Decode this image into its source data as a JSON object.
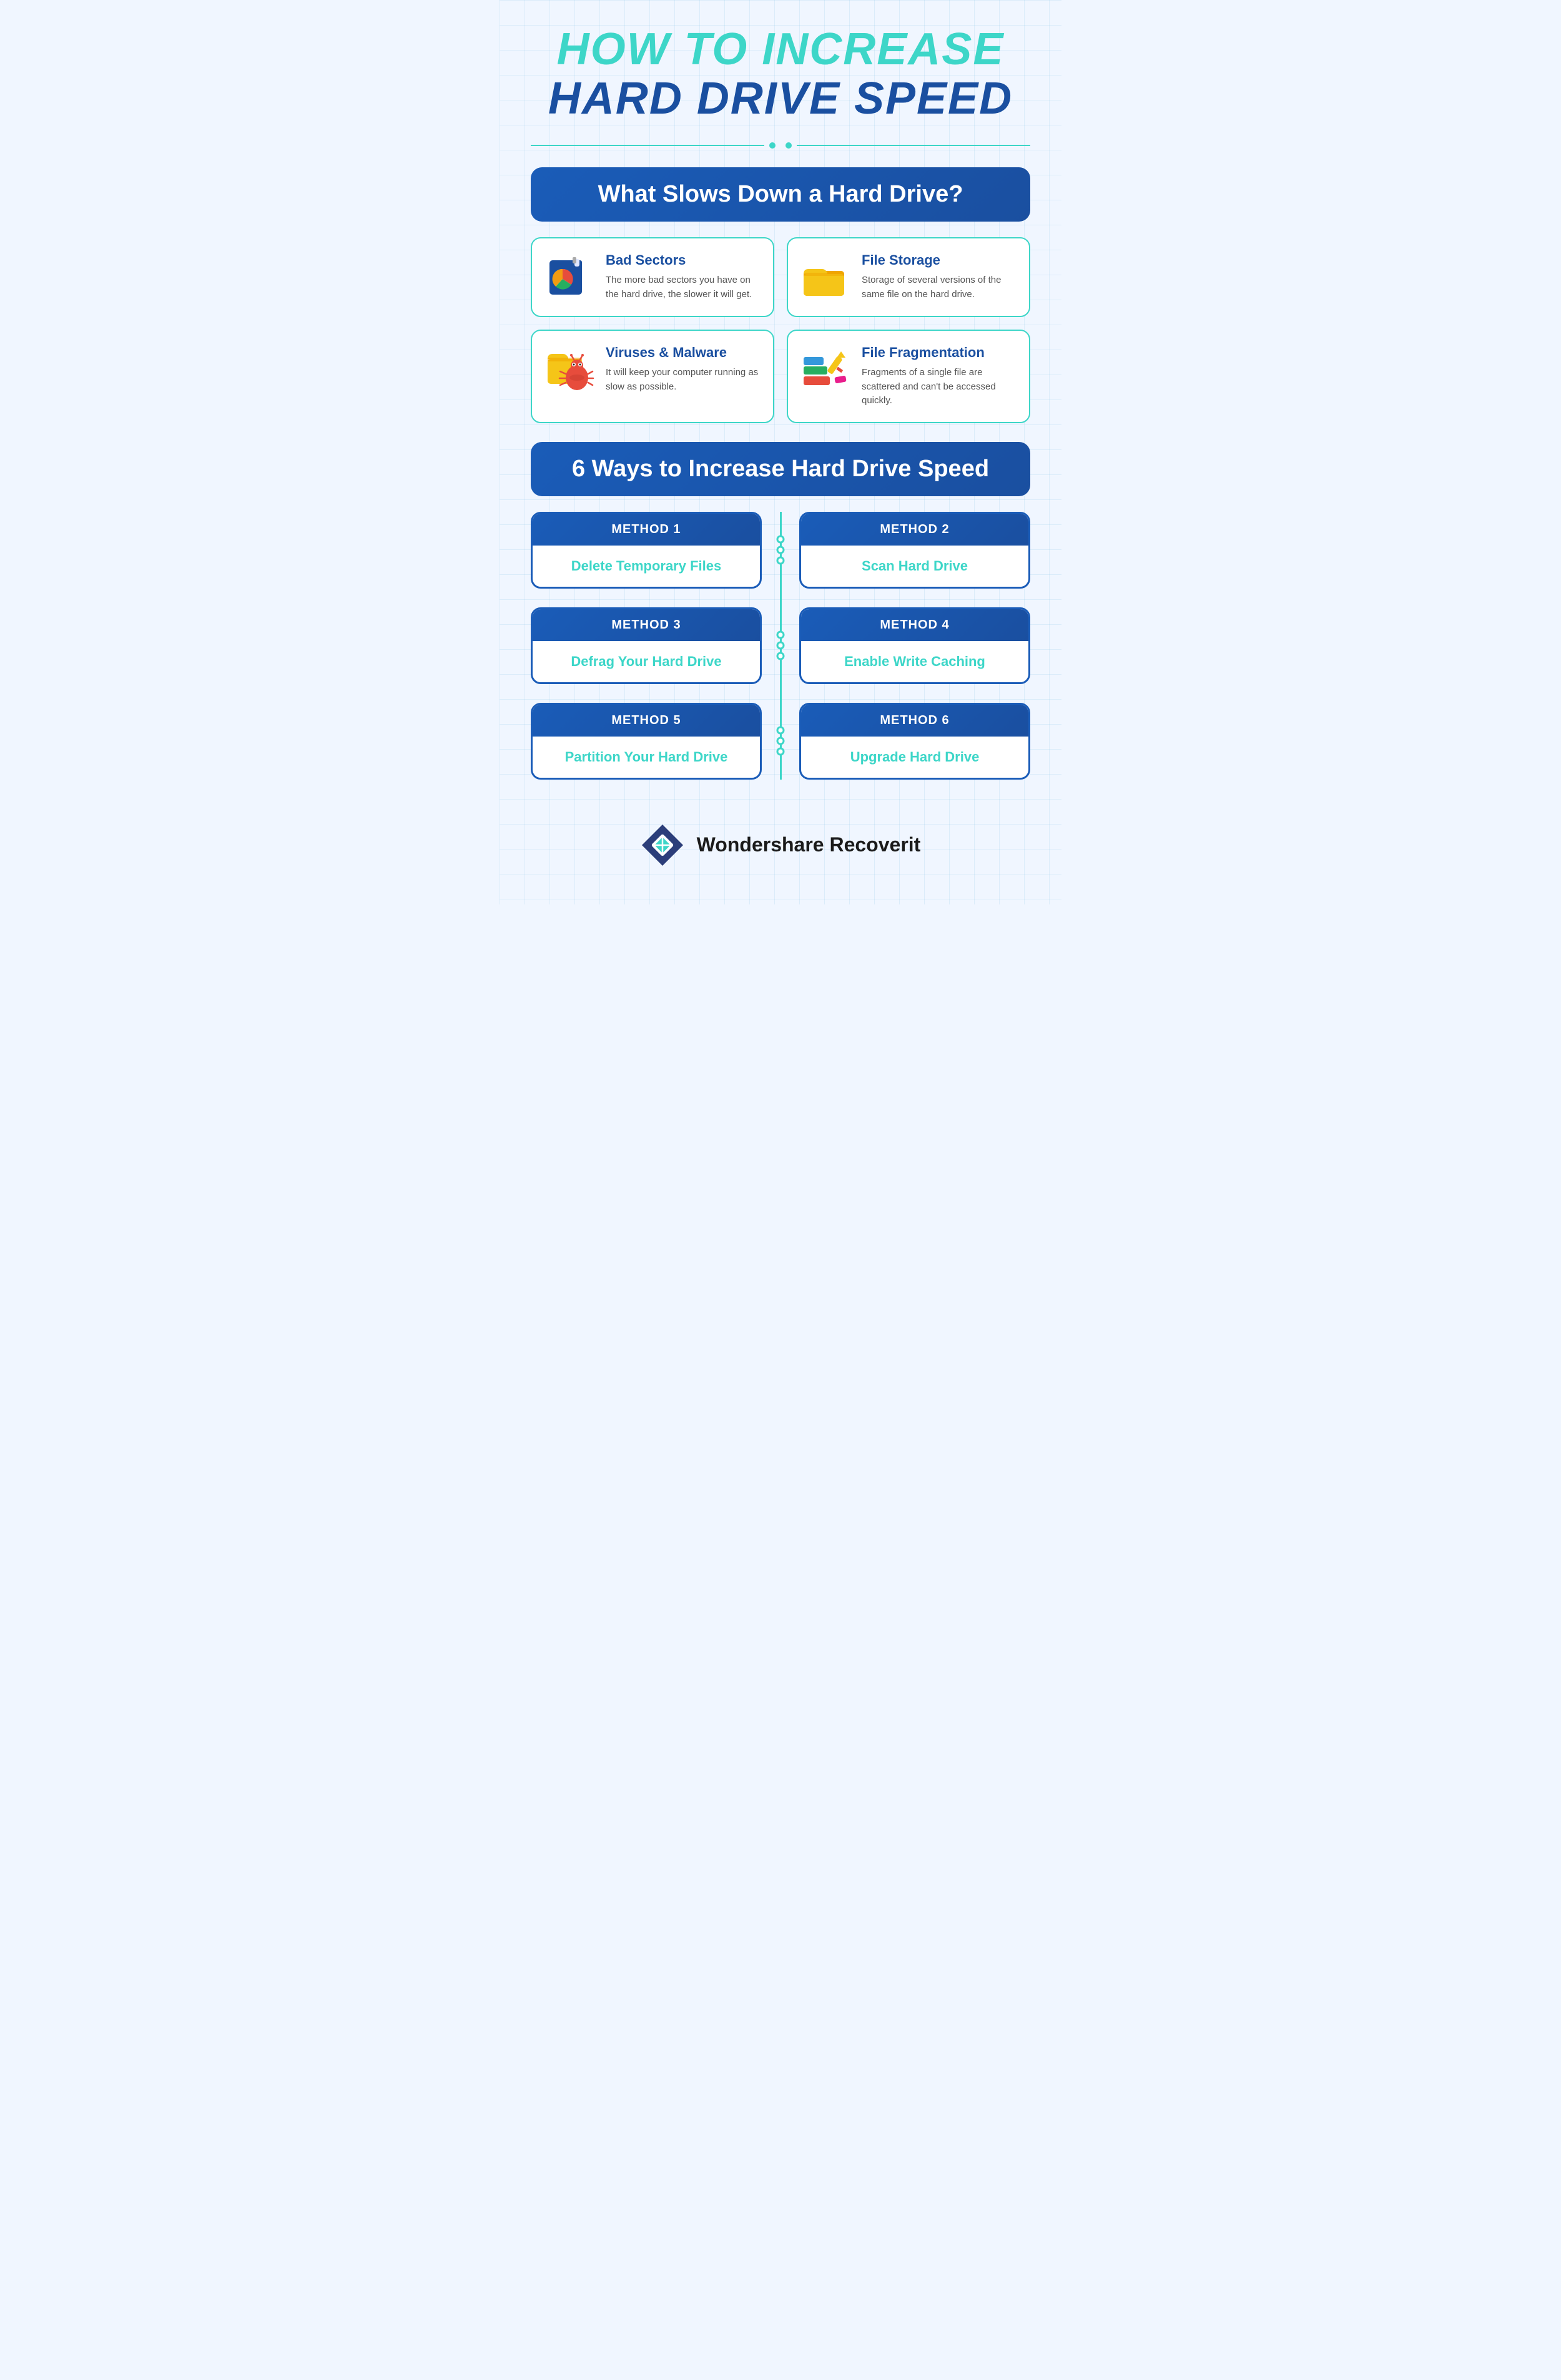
{
  "title": {
    "line1": "HOW TO  INCREASE",
    "line2": "HARD DRIVE SPEED"
  },
  "section1": {
    "header": "What Slows Down a Hard Drive?",
    "cards": [
      {
        "id": "bad-sectors",
        "title": "Bad Sectors",
        "description": "The more bad sectors you have on the hard drive, the slower it will get."
      },
      {
        "id": "file-storage",
        "title": "File Storage",
        "description": "Storage of several versions of the same file on the hard drive."
      },
      {
        "id": "viruses",
        "title": "Viruses & Malware",
        "description": "It will keep your computer running as slow as possible."
      },
      {
        "id": "file-fragmentation",
        "title": "File Fragmentation",
        "description": "Fragments of a single file are scattered and can't be accessed quickly."
      }
    ]
  },
  "section2": {
    "header": "6 Ways to Increase Hard Drive Speed",
    "methods": [
      {
        "id": "method1",
        "label": "METHOD 1",
        "name": "Delete Temporary Files"
      },
      {
        "id": "method2",
        "label": "METHOD 2",
        "name": "Scan Hard Drive"
      },
      {
        "id": "method3",
        "label": "METHOD 3",
        "name": "Defrag Your Hard Drive"
      },
      {
        "id": "method4",
        "label": "METHOD 4",
        "name": "Enable Write Caching"
      },
      {
        "id": "method5",
        "label": "METHOD 5",
        "name": "Partition Your Hard Drive"
      },
      {
        "id": "method6",
        "label": "METHOD 6",
        "name": "Upgrade Hard Drive"
      }
    ]
  },
  "logo": {
    "name": "Wondershare Recoverit"
  },
  "colors": {
    "accent": "#3dd6c8",
    "primary": "#1a4fa0",
    "dark": "#1a1a1a"
  }
}
